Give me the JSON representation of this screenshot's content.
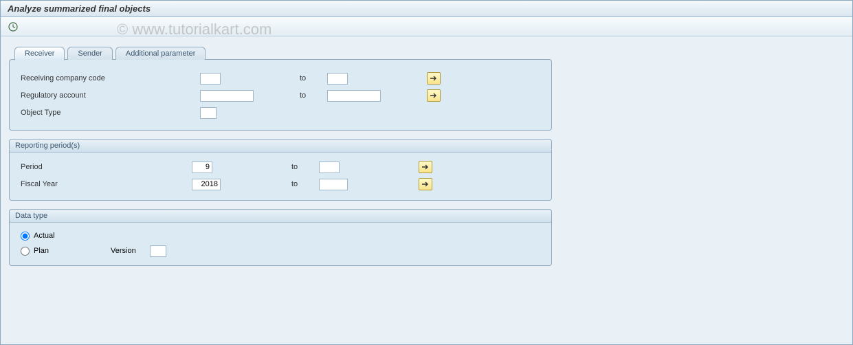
{
  "title": "Analyze summarized final objects",
  "watermark": "© www.tutorialkart.com",
  "tabs": {
    "receiver": "Receiver",
    "sender": "Sender",
    "additional": "Additional parameter"
  },
  "receiver_panel": {
    "company_code_label": "Receiving company code",
    "regulatory_label": "Regulatory account",
    "object_type_label": "Object Type",
    "to": "to"
  },
  "reporting": {
    "title": "Reporting period(s)",
    "period_label": "Period",
    "period_from": "9",
    "fiscal_label": "Fiscal Year",
    "fiscal_from": "2018",
    "to": "to"
  },
  "datatype": {
    "title": "Data type",
    "actual_label": "Actual",
    "plan_label": "Plan",
    "version_label": "Version"
  }
}
